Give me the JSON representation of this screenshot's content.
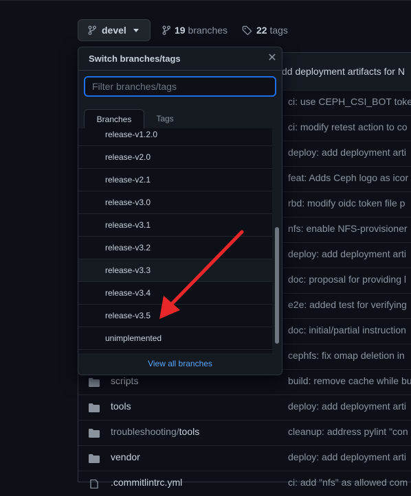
{
  "repo": {
    "branch_button_label": "devel",
    "branches_count": "19",
    "branches_label": "branches",
    "tags_count": "22",
    "tags_label": "tags"
  },
  "files": {
    "header_commit": "dd deployment artifacts for N",
    "rows": [
      {
        "name": "",
        "commit": "ci: use CEPH_CSI_BOT toke"
      },
      {
        "name": "",
        "commit": "ci: modify retest action to co"
      },
      {
        "name": "",
        "commit": "deploy: add deployment arti"
      },
      {
        "name": "",
        "commit": "feat: Adds Ceph logo as icor"
      },
      {
        "name": "",
        "commit": "rbd: modify oidc token file p"
      },
      {
        "name": "",
        "commit": "nfs: enable NFS-provisioner"
      },
      {
        "name": "",
        "commit": "deploy: add deployment arti"
      },
      {
        "name": "",
        "commit": "doc: proposal for providing l"
      },
      {
        "name": "",
        "commit": "e2e: added test for verifying"
      },
      {
        "name": "",
        "commit": "doc: initial/partial instruction"
      },
      {
        "name": "",
        "commit": "cephfs: fix omap deletion in"
      },
      {
        "name": "scripts",
        "commit": "build: remove cache while bu"
      },
      {
        "name": "tools",
        "commit": "deploy: add deployment arti"
      },
      {
        "name_dim": "troubleshooting/",
        "name": "tools",
        "commit": "cleanup: address pylint \"con"
      },
      {
        "name": "vendor",
        "commit": "deploy: add deployment arti"
      },
      {
        "name": ".commitlintrc.yml",
        "commit": "ci: add \"nfs\" as allowed com"
      }
    ]
  },
  "dropdown": {
    "title": "Switch branches/tags",
    "filter_placeholder": "Filter branches/tags",
    "filter_value": "",
    "tabs": [
      "Branches",
      "Tags"
    ],
    "branches": [
      "release-v1.2.0",
      "release-v2.0",
      "release-v2.1",
      "release-v3.0",
      "release-v3.1",
      "release-v3.2",
      "release-v3.3",
      "release-v3.4",
      "release-v3.5",
      "unimplemented"
    ],
    "hovered_branch": "release-v3.3",
    "view_all_label": "View all branches"
  },
  "colors": {
    "background": "#0d1117",
    "accent_blue": "#58a6ff",
    "focus_border": "#1f6feb",
    "annotation_arrow": "#e8272b"
  }
}
